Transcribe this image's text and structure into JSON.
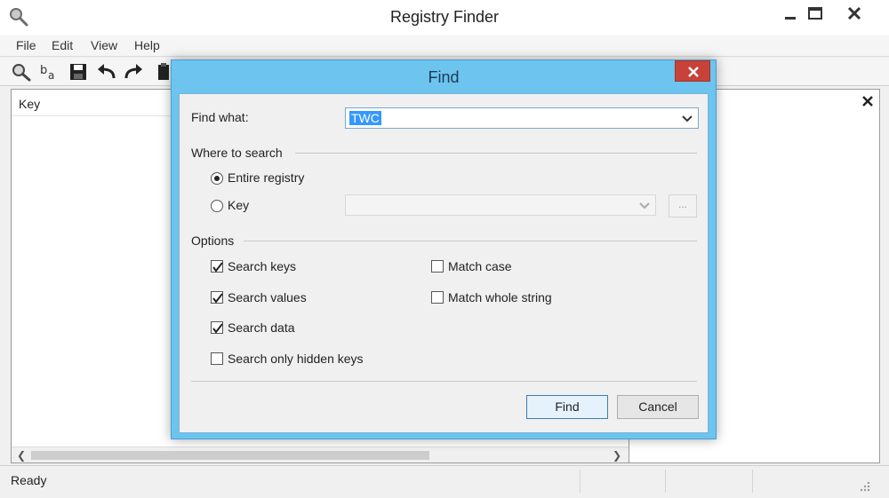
{
  "window": {
    "title": "Registry Finder"
  },
  "menu": [
    "File",
    "Edit",
    "View",
    "Help"
  ],
  "toolbar_icons": [
    "search-icon",
    "replace-icon",
    "save-icon",
    "undo-icon",
    "redo-icon",
    "clipboard-icon"
  ],
  "pane": {
    "column_header": "Key"
  },
  "status": {
    "text": "Ready"
  },
  "dialog": {
    "title": "Find",
    "find_what_label": "Find what:",
    "find_what_value": "TWC",
    "where_to_search": {
      "label": "Where to search",
      "entire_registry": {
        "label": "Entire registry",
        "selected": true
      },
      "key": {
        "label": "Key",
        "selected": false,
        "value": "",
        "browse_label": "..."
      }
    },
    "options": {
      "label": "Options",
      "search_keys": {
        "label": "Search keys",
        "checked": true
      },
      "search_values": {
        "label": "Search values",
        "checked": true
      },
      "search_data": {
        "label": "Search data",
        "checked": true
      },
      "search_only_hidden_keys": {
        "label": "Search only hidden keys",
        "checked": false
      },
      "match_case": {
        "label": "Match case",
        "checked": false
      },
      "match_whole_string": {
        "label": "Match whole string",
        "checked": false
      }
    },
    "find_button": "Find",
    "cancel_button": "Cancel"
  },
  "colors": {
    "dialog_frame": "#6cc4ef",
    "close_button": "#c7433a",
    "selection": "#3399ff"
  }
}
